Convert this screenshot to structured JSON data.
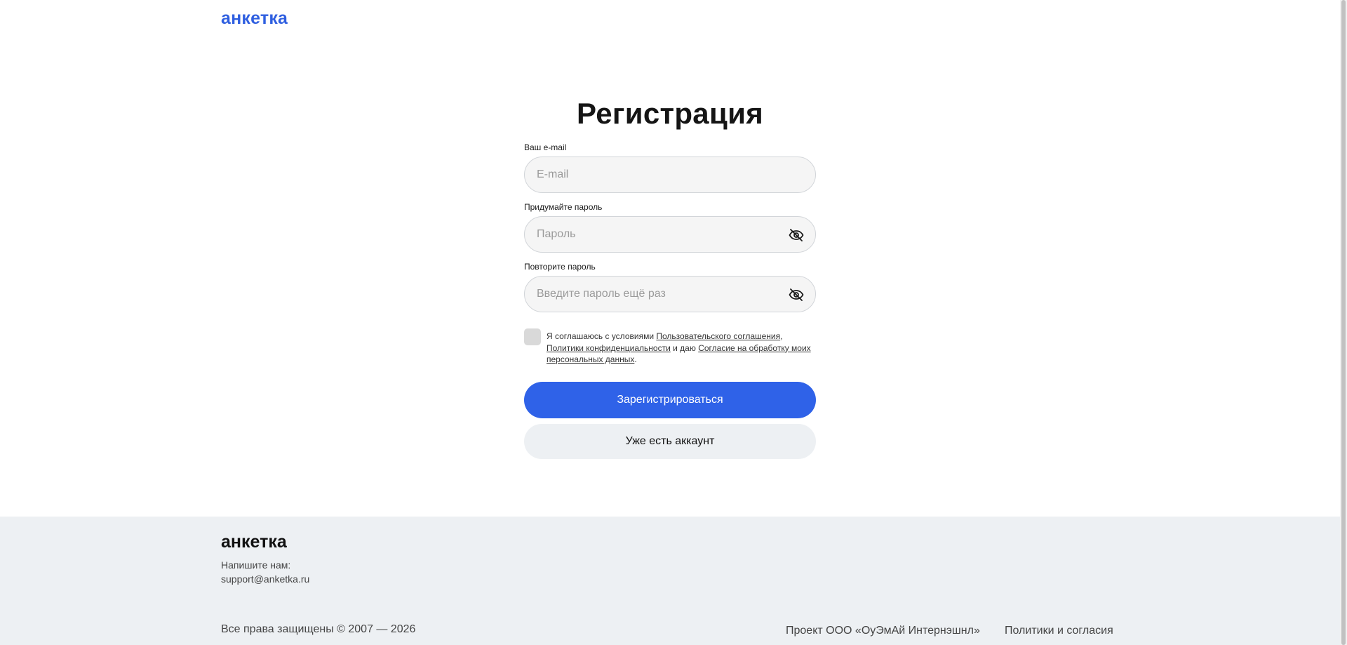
{
  "header": {
    "logo": "анкетка"
  },
  "form": {
    "title": "Регистрация",
    "email": {
      "label": "Ваш e-mail",
      "placeholder": "E-mail",
      "value": ""
    },
    "password": {
      "label": "Придумайте пароль",
      "placeholder": "Пароль",
      "value": ""
    },
    "password_repeat": {
      "label": "Повторите пароль",
      "placeholder": "Введите пароль ещё раз",
      "value": ""
    },
    "agreement": {
      "checked": false,
      "text_1": "Я соглашаюсь с условиями ",
      "link_user_agreement": "Пользовательского соглашения",
      "text_2": ", ",
      "link_privacy": "Политики конфиденциальности",
      "text_3": " и даю ",
      "link_consent": "Согласие на обработку моих персональных данных",
      "text_4": "."
    },
    "submit_label": "Зарегистрироваться",
    "login_label": "Уже есть аккаунт"
  },
  "footer": {
    "logo": "анкетка",
    "contact_label": "Напишите нам:",
    "email": "support@anketka.ru",
    "copyright": "Все права защищены © 2007 — 2026",
    "project": "Проект ООО «ОуЭмАй Интернэшнл»",
    "policies": "Политики и согласия"
  },
  "colors": {
    "brand_blue": "#2f62e8",
    "footer_bg": "#edf0f3",
    "input_bg": "#f5f5f5"
  },
  "icons": {
    "password_toggle": "eye-slash-icon"
  }
}
